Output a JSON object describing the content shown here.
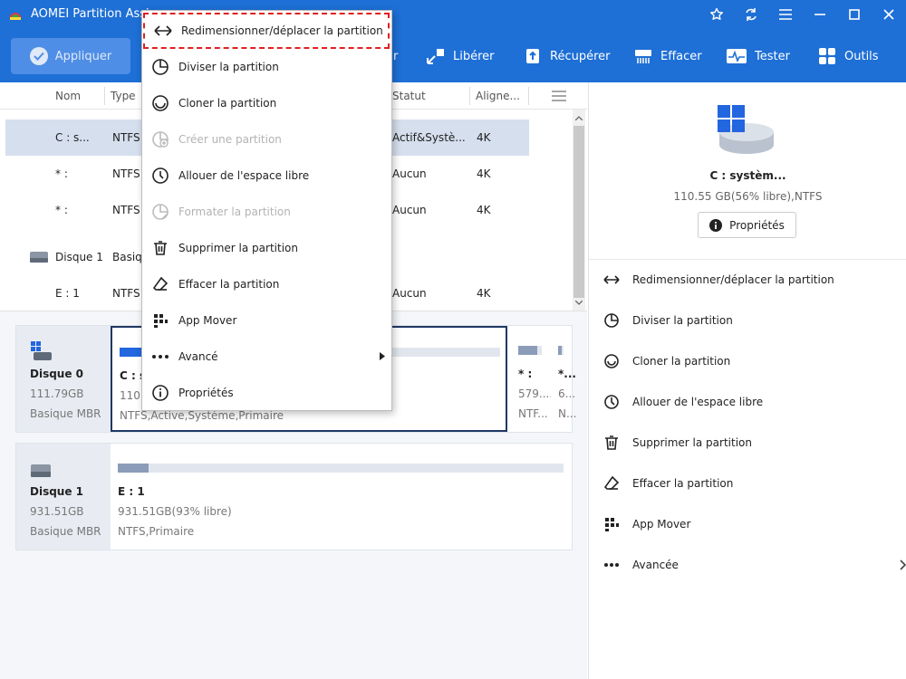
{
  "window": {
    "title": "AOMEI Partition Assi"
  },
  "toolbar": {
    "apply": "Appliquer",
    "partial_label": "r",
    "items": [
      "Libérer",
      "Récupérer",
      "Effacer",
      "Tester",
      "Outils"
    ]
  },
  "table": {
    "headers": [
      "Nom",
      "Type",
      "Statut",
      "Aligne..."
    ],
    "rows": [
      {
        "name": "C : s...",
        "type": "NTFS",
        "status": "Actif&Systè...",
        "align": "4K"
      },
      {
        "name": "* :",
        "type": "NTFS",
        "status": "Aucun",
        "align": "4K"
      },
      {
        "name": "* :",
        "type": "NTFS",
        "status": "Aucun",
        "align": "4K"
      },
      {
        "name": "Disque 1",
        "type": "Basiq",
        "status": "",
        "align": ""
      },
      {
        "name": "E : 1",
        "type": "NTFS",
        "status": "Aucun",
        "align": "4K"
      }
    ]
  },
  "disks": [
    {
      "name": "Disque 0",
      "size": "111.79GB",
      "type": "Basique MBR",
      "partitions": [
        {
          "name": "C : s",
          "size": "110.5",
          "fs": "NTFS,Active,Système,Primaire",
          "fill": 0.1
        },
        {
          "name": "* :",
          "size": "579....",
          "fs": "NTF...",
          "fill": 0.8
        },
        {
          "name": "*...",
          "size": "6...",
          "fs": "N...",
          "fill": 0.6
        }
      ]
    },
    {
      "name": "Disque 1",
      "size": "931.51GB",
      "type": "Basique MBR",
      "partitions": [
        {
          "name": "E : 1",
          "size": "931.51GB(93% libre)",
          "fs": "NTFS,Primaire",
          "fill": 0.07
        }
      ]
    }
  ],
  "right_panel": {
    "partition_name": "C : systèm...",
    "partition_info": "110.55 GB(56% libre),NTFS",
    "properties_button": "Propriétés",
    "operations": [
      "Redimensionner/déplacer la partition",
      "Diviser la partition",
      "Cloner la partition",
      "Allouer de l'espace libre",
      "Supprimer la partition",
      "Effacer la partition",
      "App Mover",
      "Avancée"
    ]
  },
  "context_menu": {
    "items": [
      {
        "label": "Redimensionner/déplacer la partition",
        "enabled": true
      },
      {
        "label": "Diviser la partition",
        "enabled": true
      },
      {
        "label": "Cloner la partition",
        "enabled": true
      },
      {
        "label": "Créer une partition",
        "enabled": false
      },
      {
        "label": "Allouer de l'espace libre",
        "enabled": true
      },
      {
        "label": "Formater la partition",
        "enabled": false
      },
      {
        "label": "Supprimer la partition",
        "enabled": true
      },
      {
        "label": "Effacer la partition",
        "enabled": true
      },
      {
        "label": "App Mover",
        "enabled": true
      },
      {
        "label": "Avancé",
        "enabled": true
      },
      {
        "label": "Propriétés",
        "enabled": true
      }
    ]
  },
  "colors": {
    "accent": "#1e6fd6",
    "selected_row": "#d5dfee",
    "highlight_border": "#e02020",
    "bar_fill": "#2266e0"
  }
}
